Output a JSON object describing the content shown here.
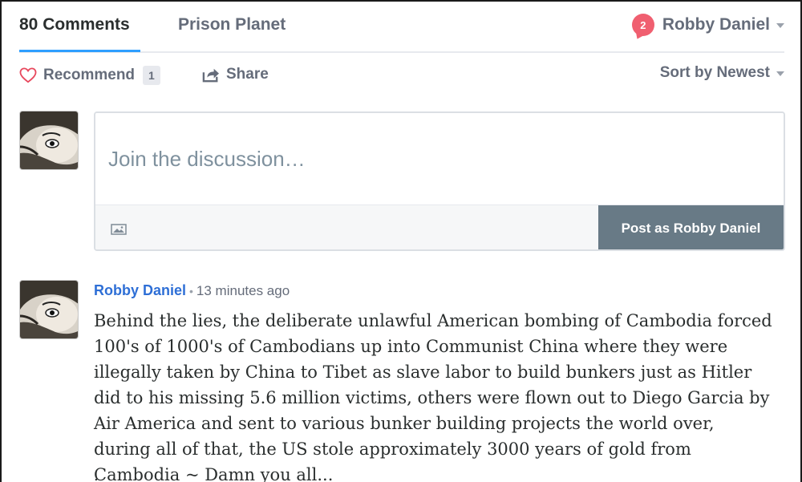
{
  "nav": {
    "comments_tab": "80 Comments",
    "community_tab": "Prison Planet",
    "notification_count": "2",
    "user_name": "Robby Daniel"
  },
  "actions": {
    "recommend_label": "Recommend",
    "recommend_count": "1",
    "share_label": "Share",
    "sort_label": "Sort by Newest"
  },
  "composer": {
    "placeholder": "Join the discussion…",
    "post_button": "Post as Robby Daniel"
  },
  "comments": [
    {
      "author": "Robby Daniel",
      "bullet": "•",
      "time": "13 minutes ago",
      "text": "Behind the lies, the deliberate unlawful American bombing of Cambodia forced 100's of 1000's of Cambodians up into Communist China where they were illegally taken by China to Tibet as slave labor to build bunkers just as Hitler did to his missing 5.6 million victims, others were flown out to Diego Garcia by Air America and sent to various bunker building projects the world over, during all of that, the US stole approximately 3000 years of gold from Cambodia ~ Damn you all...",
      "more": "."
    }
  ],
  "colors": {
    "accent_blue": "#2e9fff",
    "link_blue": "#2e6fd6",
    "badge_red": "#f05f70",
    "button_gray": "#687a86",
    "muted_text": "#656c7a"
  },
  "icons": {
    "heart": "heart-icon",
    "share": "share-icon",
    "image": "image-icon",
    "caret": "chevron-down-icon"
  }
}
